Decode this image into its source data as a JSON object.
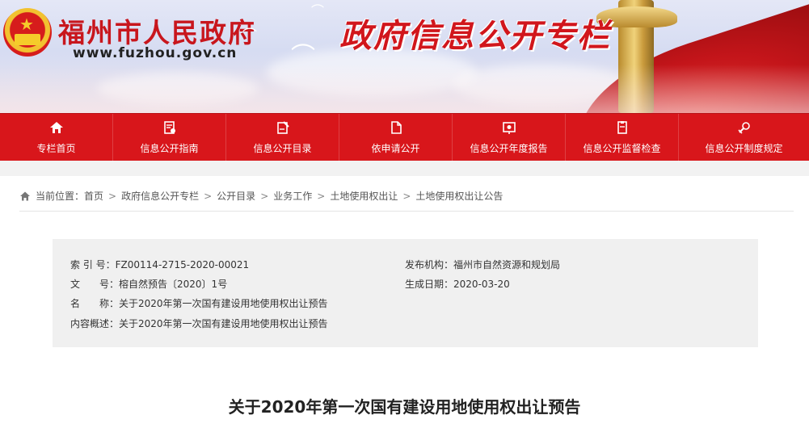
{
  "header": {
    "site_title": "福州市人民政府",
    "site_url": "www.fuzhou.gov.cn",
    "column_title": "政府信息公开专栏"
  },
  "nav": [
    {
      "label": "专栏首页",
      "icon": "home-icon"
    },
    {
      "label": "信息公开指南",
      "icon": "guide-icon"
    },
    {
      "label": "信息公开目录",
      "icon": "catalog-icon"
    },
    {
      "label": "依申请公开",
      "icon": "document-icon"
    },
    {
      "label": "信息公开年度报告",
      "icon": "report-icon"
    },
    {
      "label": "信息公开监督检查",
      "icon": "inspection-icon"
    },
    {
      "label": "信息公开制度规定",
      "icon": "regulation-icon"
    }
  ],
  "breadcrumb": {
    "prefix": "当前位置：",
    "items": [
      "首页",
      "政府信息公开专栏",
      "公开目录",
      "业务工作",
      "土地使用权出让",
      "土地使用权出让公告"
    ],
    "separator": ">"
  },
  "meta": {
    "index_label": "索 引 号：",
    "index_value": "FZ00114-2715-2020-00021",
    "publisher_label": "发布机构：",
    "publisher_value": "福州市自然资源和规划局",
    "doc_no_label": "文　　号：",
    "doc_no_value": "榕自然预告〔2020〕1号",
    "date_label": "生成日期：",
    "date_value": "2020-03-20",
    "name_label": "名　　称：",
    "name_value": "关于2020年第一次国有建设用地使用权出让预告",
    "summary_label": "内容概述：",
    "summary_value": "关于2020年第一次国有建设用地使用权出让预告"
  },
  "article": {
    "title": "关于2020年第一次国有建设用地使用权出让预告"
  },
  "colors": {
    "nav_red": "#d8161b",
    "title_red": "#c8161d",
    "meta_bg": "#f0f0f0"
  }
}
